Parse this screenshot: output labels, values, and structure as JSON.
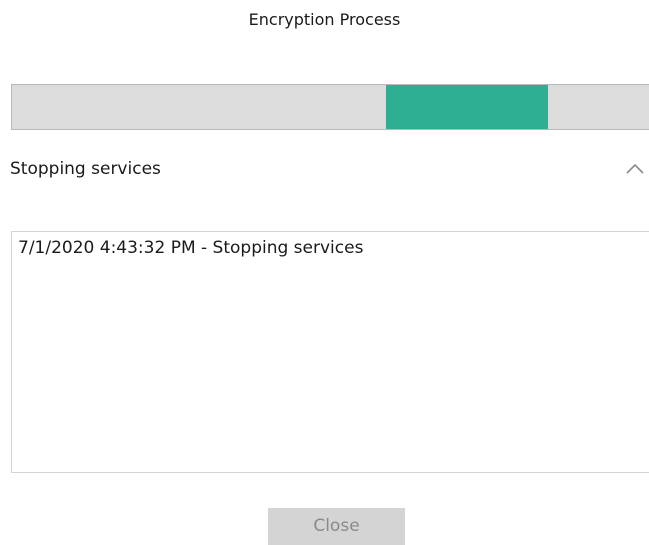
{
  "window": {
    "title": "Encryption Process"
  },
  "progress": {
    "mode": "indeterminate",
    "accent_color": "#2faf91"
  },
  "status": {
    "label": "Stopping services",
    "toggle_icon": "chevron-up-icon"
  },
  "log": {
    "lines": [
      "7/1/2020 4:43:32 PM - Stopping services"
    ]
  },
  "footer": {
    "close_label": "Close",
    "close_enabled": false
  }
}
